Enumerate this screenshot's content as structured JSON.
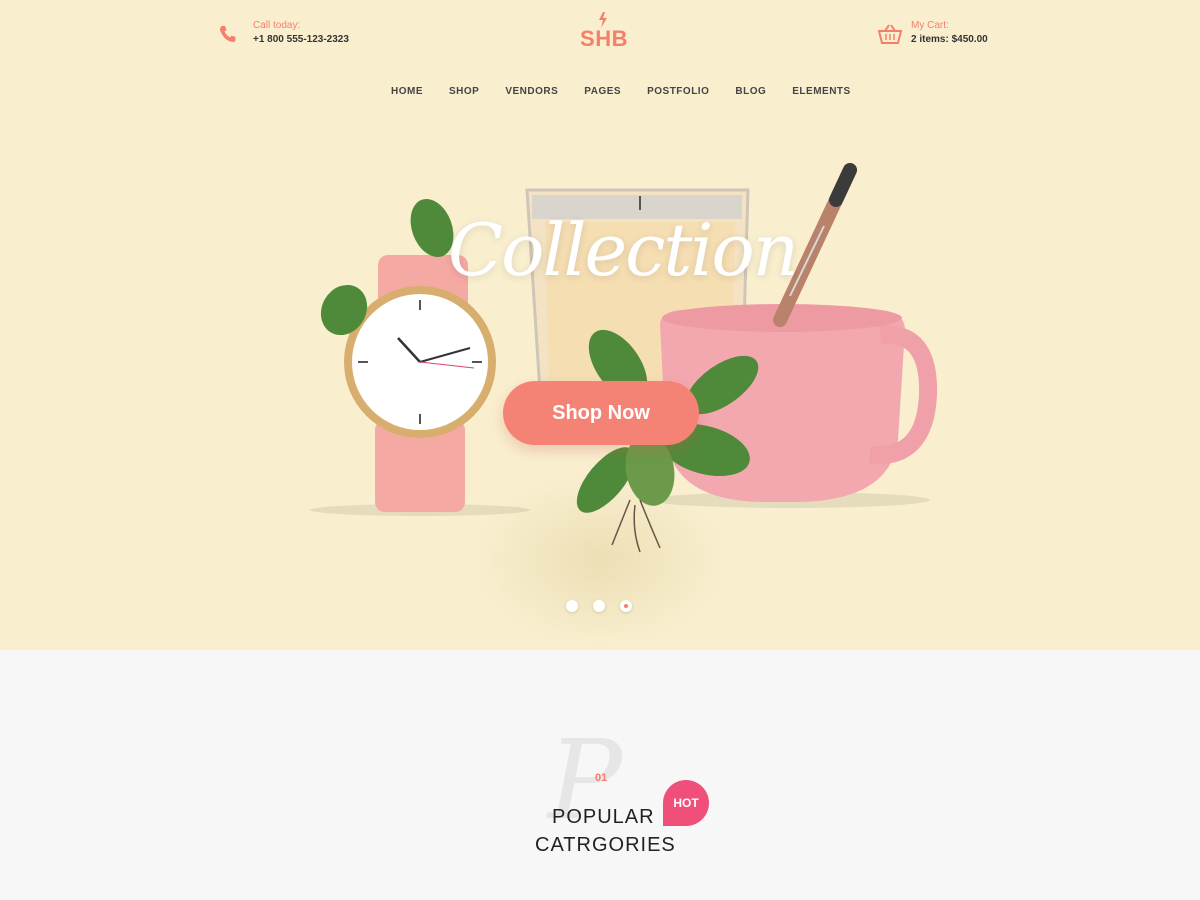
{
  "header": {
    "call_label": "Call today:",
    "call_number": "+1 800 555-123-2323",
    "logo_text": "SHB",
    "cart_label": "My Cart:",
    "cart_summary": "2 items: $450.00"
  },
  "nav": {
    "items": [
      "HOME",
      "SHOP",
      "VENDORS",
      "PAGES",
      "POSTFOLIO",
      "BLOG",
      "ELEMENTS"
    ]
  },
  "hero": {
    "script_title": "Collection",
    "cta_label": "Shop Now",
    "slides": 3,
    "active_slide": 3
  },
  "section": {
    "watermark_letter": "P",
    "number": "01",
    "title_line1": "POPULAR",
    "title_line2": "CATRGORIES",
    "badge": "HOT"
  },
  "colors": {
    "accent": "#f47f6b",
    "hero_bg": "#f9efcf",
    "badge": "#ef4f78"
  }
}
